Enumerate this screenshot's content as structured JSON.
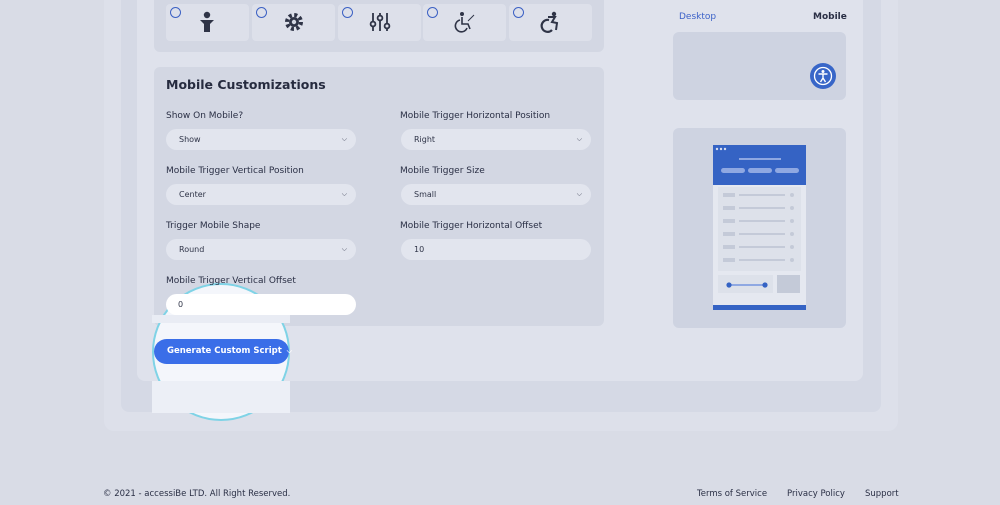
{
  "mobile_customizations": {
    "title": "Mobile Customizations",
    "show_on_mobile": {
      "label": "Show On Mobile?",
      "value": "Show"
    },
    "horizontal_position": {
      "label": "Mobile Trigger Horizontal Position",
      "value": "Right"
    },
    "vertical_position": {
      "label": "Mobile Trigger Vertical Position",
      "value": "Center"
    },
    "trigger_size": {
      "label": "Mobile Trigger Size",
      "value": "Small"
    },
    "trigger_shape": {
      "label": "Trigger Mobile Shape",
      "value": "Round"
    },
    "horizontal_offset": {
      "label": "Mobile Trigger Horizontal Offset",
      "value": "10"
    },
    "vertical_offset": {
      "label": "Mobile Trigger Vertical Offset",
      "value": "0"
    }
  },
  "icon_options": [
    "person-icon",
    "gear-icon",
    "sliders-icon",
    "wheelchair-icon",
    "wheelchair-active-icon"
  ],
  "generate_button": {
    "label": "Generate Custom Script"
  },
  "preview": {
    "tab_desktop": "Desktop",
    "tab_mobile": "Mobile"
  },
  "footer": {
    "copyright": "© 2021 - accessiBe LTD. All Right Reserved.",
    "terms": "Terms of Service",
    "privacy": "Privacy Policy",
    "support": "Support"
  },
  "colors": {
    "accent": "#3a6ee8",
    "spotlight_ring": "#7fd3e6"
  }
}
